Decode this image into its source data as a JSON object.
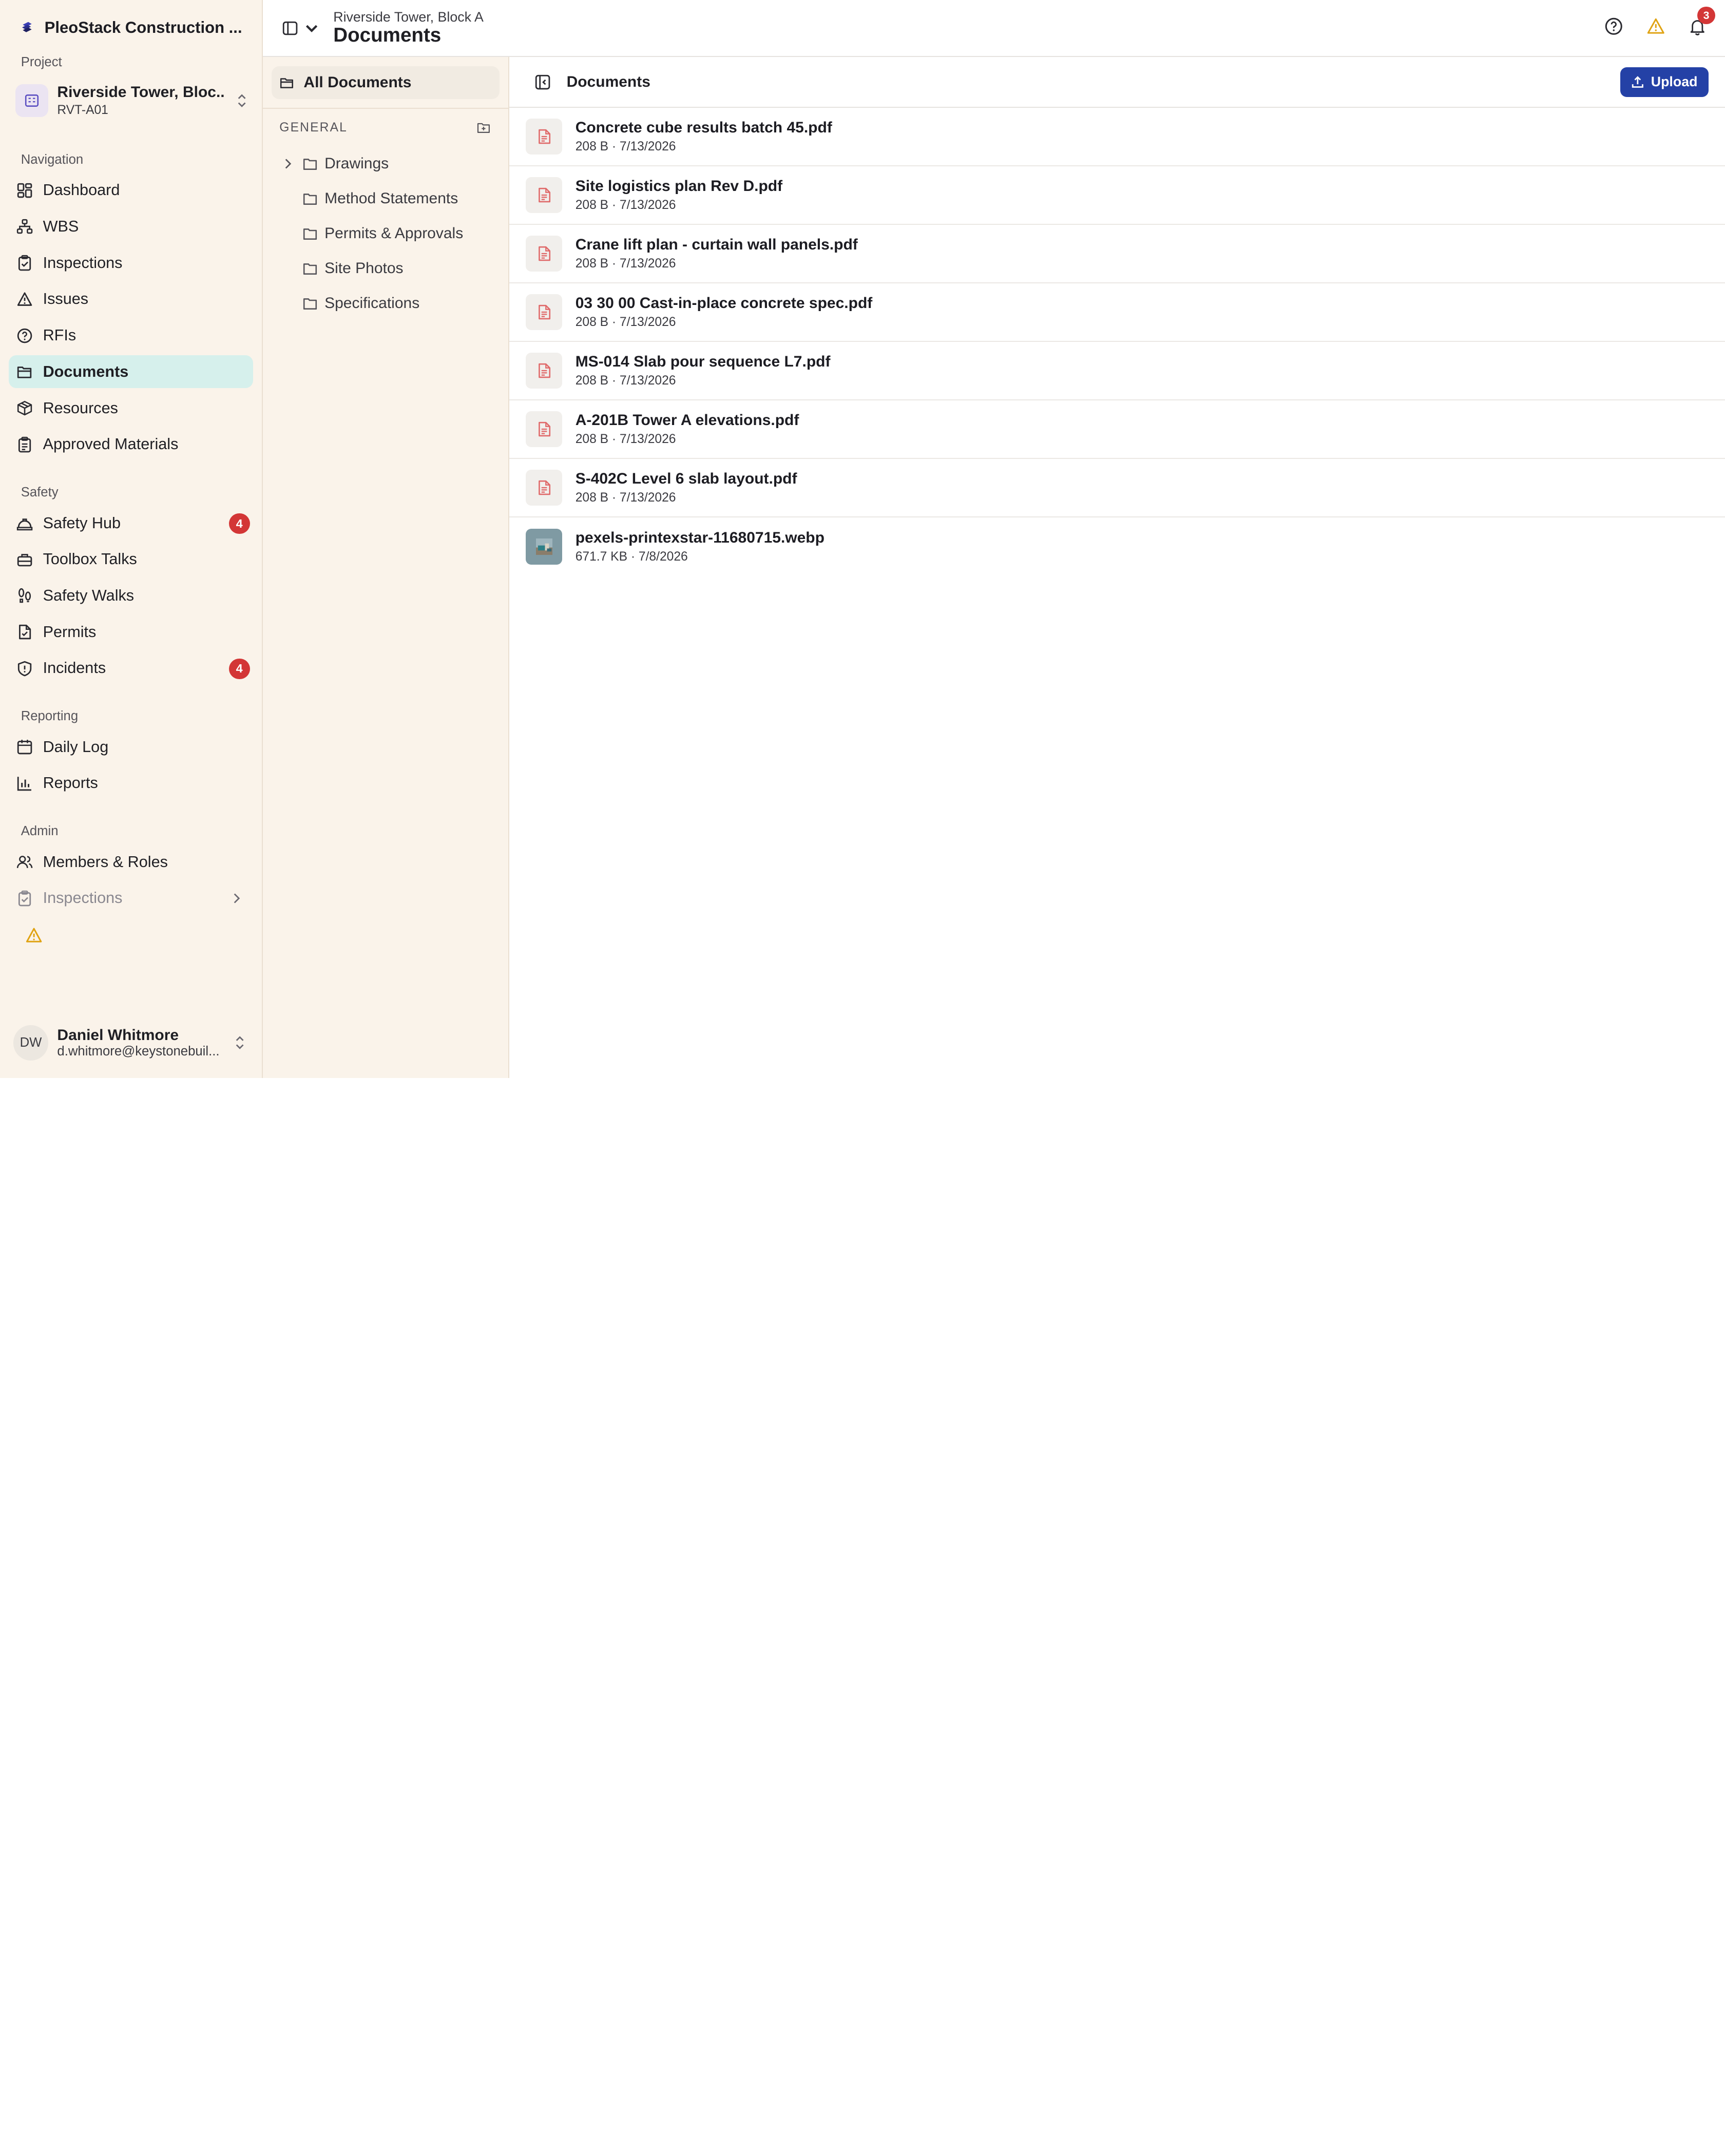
{
  "app": {
    "name": "PleoStack Construction ..."
  },
  "sidebar": {
    "project_label": "Project",
    "project": {
      "name": "Riverside Tower, Bloc...",
      "code": "RVT-A01"
    },
    "groups": [
      {
        "label": "Navigation",
        "items": [
          {
            "label": "Dashboard",
            "icon": "dashboard-icon"
          },
          {
            "label": "WBS",
            "icon": "hierarchy-icon"
          },
          {
            "label": "Inspections",
            "icon": "clipboard-check-icon"
          },
          {
            "label": "Issues",
            "icon": "warning-icon"
          },
          {
            "label": "RFIs",
            "icon": "question-circle-icon"
          },
          {
            "label": "Documents",
            "icon": "folder-open-icon",
            "active": true
          },
          {
            "label": "Resources",
            "icon": "package-icon"
          },
          {
            "label": "Approved Materials",
            "icon": "clipboard-list-icon"
          }
        ]
      },
      {
        "label": "Safety",
        "items": [
          {
            "label": "Safety Hub",
            "icon": "hard-hat-icon",
            "badge": "4"
          },
          {
            "label": "Toolbox Talks",
            "icon": "toolbox-icon"
          },
          {
            "label": "Safety Walks",
            "icon": "footprints-icon"
          },
          {
            "label": "Permits",
            "icon": "file-check-icon"
          },
          {
            "label": "Incidents",
            "icon": "shield-alert-icon",
            "badge": "4"
          }
        ]
      },
      {
        "label": "Reporting",
        "items": [
          {
            "label": "Daily Log",
            "icon": "calendar-icon"
          },
          {
            "label": "Reports",
            "icon": "bar-chart-icon"
          }
        ]
      },
      {
        "label": "Admin",
        "items": [
          {
            "label": "Members & Roles",
            "icon": "users-icon"
          },
          {
            "label": "Inspections",
            "icon": "clipboard-check-icon"
          }
        ]
      }
    ],
    "user": {
      "initials": "DW",
      "name": "Daniel Whitmore",
      "email": "d.whitmore@keystonebuil..."
    }
  },
  "header": {
    "breadcrumb_parent": "Riverside Tower, Block A",
    "title": "Documents",
    "notification_count": "3"
  },
  "folders": {
    "all_label": "All Documents",
    "section_label": "GENERAL",
    "items": [
      "Drawings",
      "Method Statements",
      "Permits & Approvals",
      "Site Photos",
      "Specifications"
    ]
  },
  "docs": {
    "title": "Documents",
    "upload_label": "Upload",
    "files": [
      {
        "name": "Concrete cube results batch 45.pdf",
        "meta": "208 B · 7/13/2026",
        "kind": "pdf"
      },
      {
        "name": "Site logistics plan Rev D.pdf",
        "meta": "208 B · 7/13/2026",
        "kind": "pdf"
      },
      {
        "name": "Crane lift plan - curtain wall panels.pdf",
        "meta": "208 B · 7/13/2026",
        "kind": "pdf"
      },
      {
        "name": "03 30 00 Cast-in-place concrete spec.pdf",
        "meta": "208 B · 7/13/2026",
        "kind": "pdf"
      },
      {
        "name": "MS-014 Slab pour sequence L7.pdf",
        "meta": "208 B · 7/13/2026",
        "kind": "pdf"
      },
      {
        "name": "A-201B Tower A elevations.pdf",
        "meta": "208 B · 7/13/2026",
        "kind": "pdf"
      },
      {
        "name": "S-402C Level 6 slab layout.pdf",
        "meta": "208 B · 7/13/2026",
        "kind": "pdf"
      },
      {
        "name": "pexels-printexstar-11680715.webp",
        "meta": "671.7 KB · 7/8/2026",
        "kind": "image"
      }
    ]
  },
  "colors": {
    "accent": "#2441a6",
    "active_nav": "#d6f0ec",
    "badge": "#d33636",
    "sidebar_bg": "#faf3ea"
  }
}
